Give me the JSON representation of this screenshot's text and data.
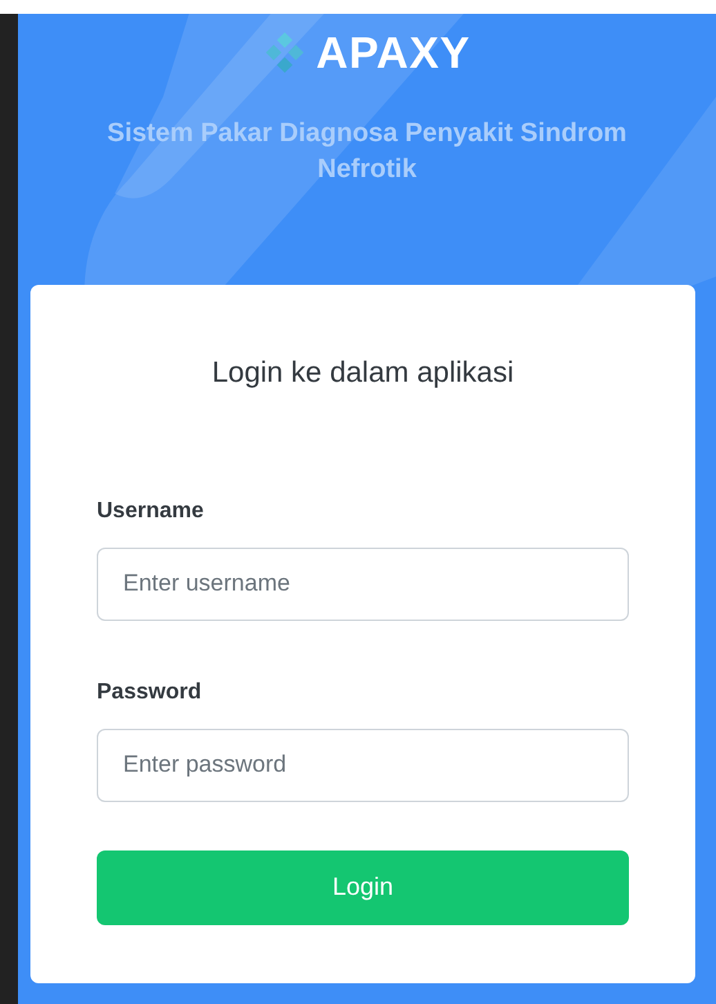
{
  "brand": {
    "name": "APAXY",
    "subtitle": "Sistem Pakar Diagnosa Penyakit Sindrom Nefrotik"
  },
  "login": {
    "heading": "Login ke dalam aplikasi",
    "fields": [
      {
        "label": "Username",
        "placeholder": "Enter username"
      },
      {
        "label": "Password",
        "placeholder": "Enter password"
      }
    ],
    "button": "Login"
  }
}
